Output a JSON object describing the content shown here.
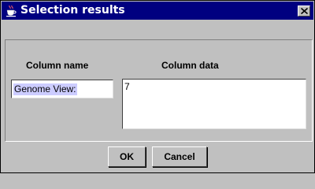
{
  "window": {
    "title": "Selection results",
    "title_icon": "java-cup-icon",
    "close_icon": "close-icon"
  },
  "labels": {
    "column_name": "Column name",
    "column_data": "Column data"
  },
  "fields": {
    "column_name_value": "Genome View:",
    "column_data_value": "7"
  },
  "buttons": {
    "ok": "OK",
    "cancel": "Cancel"
  },
  "colors": {
    "titlebar": "#000080",
    "background": "#c0c0c0",
    "selection": "#ccccff"
  }
}
